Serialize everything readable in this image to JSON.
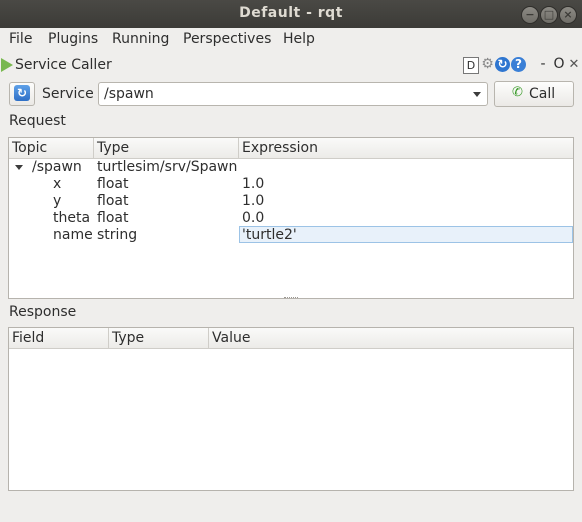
{
  "window": {
    "title": "Default - rqt",
    "buttons": [
      "−",
      "□",
      "×"
    ]
  },
  "menu": [
    "File",
    "Plugins",
    "Running",
    "Perspectives",
    "Help"
  ],
  "plugin": {
    "title": "Service Caller",
    "header_icons": {
      "d": "D",
      "gear": "⚙",
      "reload": "↻",
      "help": "?",
      "minimize": "-",
      "float": "O",
      "close": "✕"
    }
  },
  "service": {
    "label": "Service",
    "value": "/spawn",
    "call_label": "Call",
    "refresh_icon": "↻",
    "phone_icon": "✆"
  },
  "request": {
    "label": "Request",
    "columns": [
      "Topic",
      "Type",
      "Expression"
    ],
    "rows": [
      {
        "topic": "/spawn",
        "type": "turtlesim/srv/Spawn",
        "expression": ""
      },
      {
        "topic": "x",
        "type": "float",
        "expression": "1.0"
      },
      {
        "topic": "y",
        "type": "float",
        "expression": "1.0"
      },
      {
        "topic": "theta",
        "type": "float",
        "expression": "0.0"
      },
      {
        "topic": "name",
        "type": "string",
        "expression": "'turtle2'"
      }
    ]
  },
  "response": {
    "label": "Response",
    "columns": [
      "Field",
      "Type",
      "Value"
    ]
  }
}
